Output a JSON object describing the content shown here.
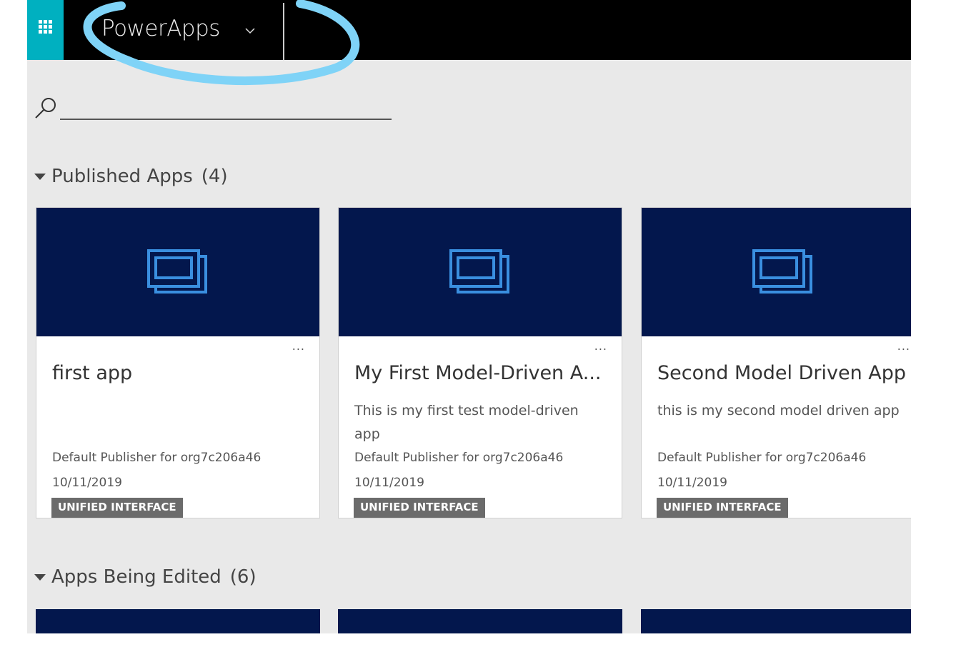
{
  "header": {
    "app_name": "PowerApps",
    "waffle_icon": "waffle-icon",
    "dropdown_icon": "chevron-down-icon"
  },
  "search": {
    "placeholder": "",
    "icon": "search-icon"
  },
  "sections": [
    {
      "title": "Published Apps",
      "count": "(4)",
      "apps": [
        {
          "name": "first app",
          "description": "",
          "publisher": "Default Publisher for org7c206a46",
          "date": "10/11/2019",
          "badge": "UNIFIED INTERFACE",
          "more": "..."
        },
        {
          "name": "My First Model-Driven A...",
          "description": "This is my first test model-driven app",
          "publisher": "Default Publisher for org7c206a46",
          "date": "10/11/2019",
          "badge": "UNIFIED INTERFACE",
          "more": "..."
        },
        {
          "name": "Second Model Driven App",
          "description": "this is my second model driven app",
          "publisher": "Default Publisher for org7c206a46",
          "date": "10/11/2019",
          "badge": "UNIFIED INTERFACE",
          "more": "..."
        }
      ]
    },
    {
      "title": "Apps Being Edited",
      "count": "(6)"
    }
  ],
  "colors": {
    "topbar": "#000000",
    "waffle": "#00b0c0",
    "tile": "#03174d",
    "tile_icon": "#3a8fe0",
    "annotation": "#7fd3f7",
    "badge": "#6b6b6b"
  }
}
